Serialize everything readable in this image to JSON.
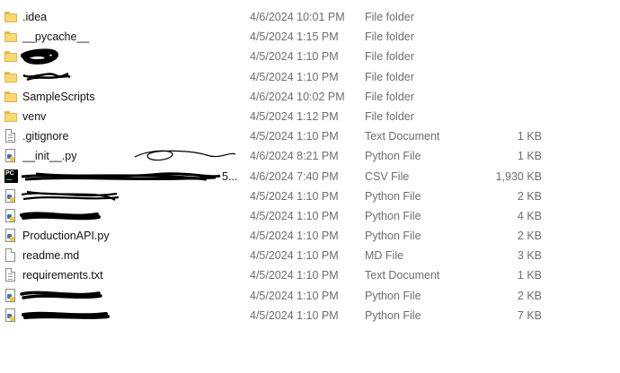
{
  "files": [
    {
      "name": ".idea",
      "date": "4/6/2024 10:01 PM",
      "type": "File folder",
      "size": "",
      "icon": "folder-icon"
    },
    {
      "name": "__pycache__",
      "date": "4/5/2024 1:15 PM",
      "type": "File folder",
      "size": "",
      "icon": "folder-icon"
    },
    {
      "name": "",
      "date": "4/5/2024 1:10 PM",
      "type": "File folder",
      "size": "",
      "icon": "folder-icon",
      "redacted": true
    },
    {
      "name": "",
      "date": "4/5/2024 1:10 PM",
      "type": "File folder",
      "size": "",
      "icon": "folder-icon",
      "redacted": true
    },
    {
      "name": "SampleScripts",
      "date": "4/6/2024 10:02 PM",
      "type": "File folder",
      "size": "",
      "icon": "folder-icon"
    },
    {
      "name": "venv",
      "date": "4/5/2024 1:12 PM",
      "type": "File folder",
      "size": "",
      "icon": "folder-icon"
    },
    {
      "name": ".gitignore",
      "date": "4/5/2024 1:10 PM",
      "type": "Text Document",
      "size": "1 KB",
      "icon": "text-document-icon"
    },
    {
      "name": "__init__.py",
      "date": "4/6/2024 8:21 PM",
      "type": "Python File",
      "size": "1 KB",
      "icon": "python-file-icon"
    },
    {
      "name": "5...",
      "date": "4/6/2024 7:40 PM",
      "type": "CSV File",
      "size": "1,930 KB",
      "icon": "pycharm-csv-icon",
      "redacted": true
    },
    {
      "name": "",
      "date": "4/5/2024 1:10 PM",
      "type": "Python File",
      "size": "2 KB",
      "icon": "python-file-icon",
      "redacted": true
    },
    {
      "name": "",
      "date": "4/5/2024 1:10 PM",
      "type": "Python File",
      "size": "4 KB",
      "icon": "python-file-icon",
      "redacted": true
    },
    {
      "name": "ProductionAPI.py",
      "date": "4/5/2024 1:10 PM",
      "type": "Python File",
      "size": "2 KB",
      "icon": "python-file-icon"
    },
    {
      "name": "readme.md",
      "date": "4/5/2024 1:10 PM",
      "type": "MD File",
      "size": "3 KB",
      "icon": "text-document-icon"
    },
    {
      "name": "requirements.txt",
      "date": "4/5/2024 1:10 PM",
      "type": "Text Document",
      "size": "1 KB",
      "icon": "text-document-icon"
    },
    {
      "name": "",
      "date": "4/5/2024 1:10 PM",
      "type": "Python File",
      "size": "2 KB",
      "icon": "python-file-icon",
      "redacted": true
    },
    {
      "name": "",
      "date": "4/5/2024 1:10 PM",
      "type": "Python File",
      "size": "7 KB",
      "icon": "python-file-icon",
      "redacted": true
    }
  ],
  "colors": {
    "text": "#111111",
    "secondary": "#6d6d6d",
    "folder": "#f8d775",
    "redaction": "#000000"
  }
}
